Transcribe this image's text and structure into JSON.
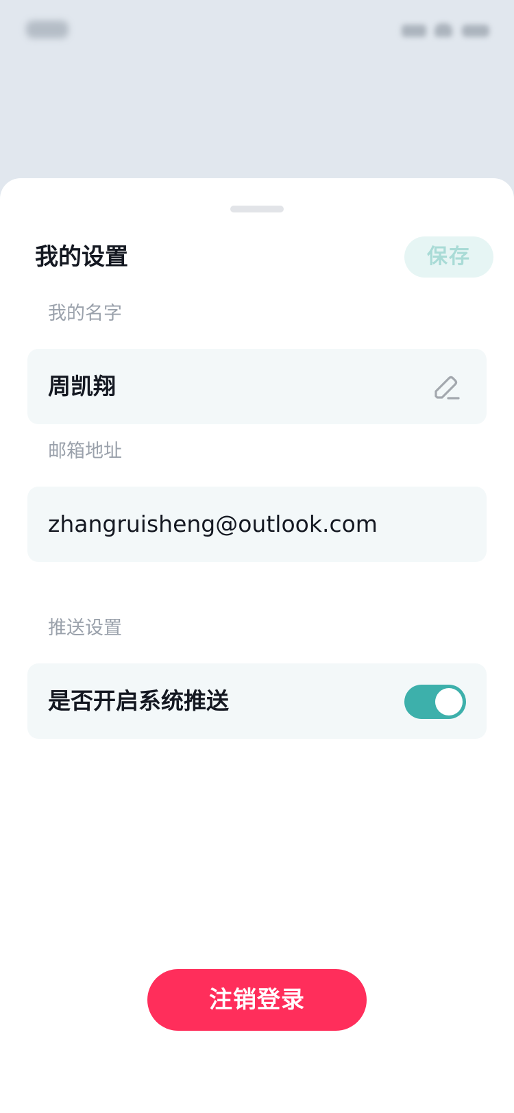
{
  "sheet": {
    "title": "我的设置",
    "save_label": "保存"
  },
  "name_field": {
    "label": "我的名字",
    "value": "周凯翔",
    "icon": "edit-pencil-icon"
  },
  "email_field": {
    "label": "邮箱地址",
    "value": "zhangruisheng@outlook.com"
  },
  "push_section": {
    "label": "推送设置",
    "toggle_label": "是否开启系统推送",
    "toggle_on": true
  },
  "logout_label": "注销登录",
  "colors": {
    "accent": "#3db0ab",
    "danger": "#ff2e5b",
    "field_bg": "#f3f8f9"
  }
}
